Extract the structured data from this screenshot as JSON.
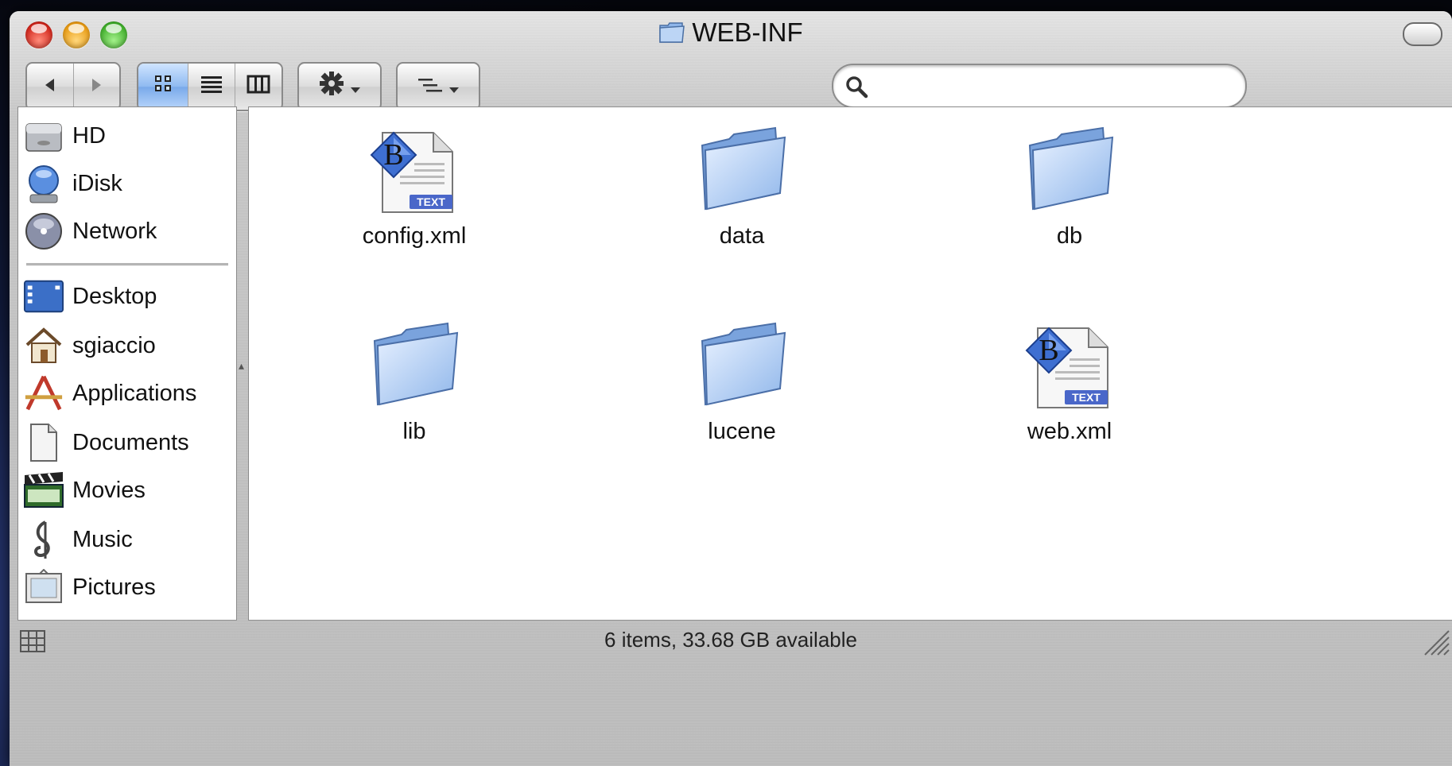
{
  "window": {
    "title": "WEB-INF",
    "title_icon": "folder-icon"
  },
  "toolbar": {
    "back_icon": "back-arrow-icon",
    "forward_icon": "forward-arrow-icon",
    "view_modes": [
      "icon-view-icon",
      "list-view-icon",
      "column-view-icon"
    ],
    "active_view": "icon-view",
    "action_icon": "gear-icon",
    "arrange_icon": "arrange-icon",
    "search": {
      "value": "",
      "placeholder": ""
    }
  },
  "sidebar": {
    "devices": [
      {
        "label": "HD",
        "icon": "hard-drive-icon"
      },
      {
        "label": "iDisk",
        "icon": "idisk-icon"
      },
      {
        "label": "Network",
        "icon": "network-icon"
      }
    ],
    "places": [
      {
        "label": "Desktop",
        "icon": "desktop-icon"
      },
      {
        "label": "sgiaccio",
        "icon": "home-icon"
      },
      {
        "label": "Applications",
        "icon": "applications-icon"
      },
      {
        "label": "Documents",
        "icon": "documents-icon"
      },
      {
        "label": "Movies",
        "icon": "movies-icon"
      },
      {
        "label": "Music",
        "icon": "music-icon"
      },
      {
        "label": "Pictures",
        "icon": "pictures-icon"
      }
    ]
  },
  "files": [
    {
      "name": "config.xml",
      "icon": "bbedit-text-file-icon",
      "badge": "TEXT"
    },
    {
      "name": "data",
      "icon": "folder-icon"
    },
    {
      "name": "db",
      "icon": "folder-icon"
    },
    {
      "name": "lib",
      "icon": "folder-icon"
    },
    {
      "name": "lucene",
      "icon": "folder-icon"
    },
    {
      "name": "web.xml",
      "icon": "bbedit-text-file-icon",
      "badge": "TEXT"
    }
  ],
  "status": {
    "text": "6 items, 33.68 GB available"
  },
  "colors": {
    "folder_blue": "#8fb6ea",
    "selection_blue": "#79a9ea"
  }
}
